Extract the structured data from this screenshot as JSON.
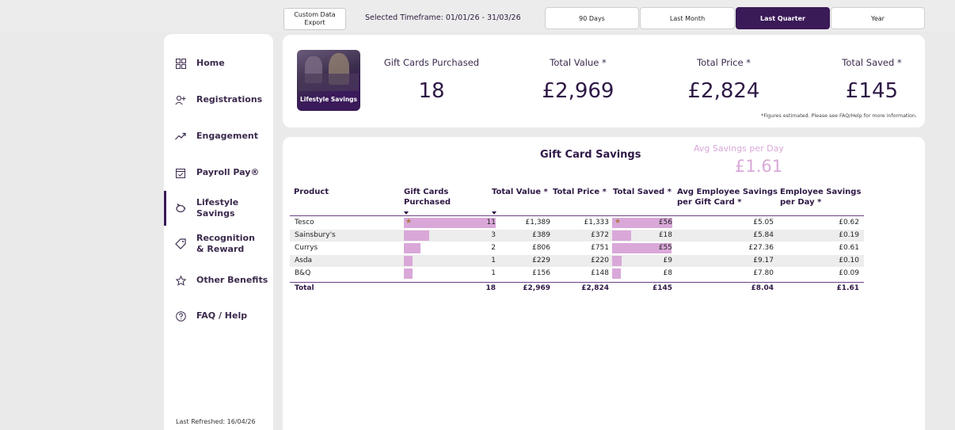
{
  "header": {
    "export_label": "Custom Data\nExport",
    "timeframe": "Selected Timeframe: 01/01/26 - 31/03/26",
    "timeframe_buttons": [
      {
        "label": "90 Days",
        "active": false
      },
      {
        "label": "Last Month",
        "active": false
      },
      {
        "label": "Last Quarter",
        "active": true
      },
      {
        "label": "Year",
        "active": false
      }
    ]
  },
  "sidebar": {
    "items": [
      {
        "label": "Home",
        "icon": "grid-icon"
      },
      {
        "label": "Registrations",
        "icon": "user-add-icon"
      },
      {
        "label": "Engagement",
        "icon": "trend-icon"
      },
      {
        "label": "Payroll Pay®",
        "icon": "calendar-check-icon"
      },
      {
        "label": "Lifestyle Savings",
        "icon": "piggy-bank-icon",
        "active": true
      },
      {
        "label": "Recognition\n& Reward",
        "icon": "tag-icon"
      },
      {
        "label": "Other Benefits",
        "icon": "star-icon"
      },
      {
        "label": "FAQ / Help",
        "icon": "help-icon"
      }
    ],
    "refreshed": "Last Refreshed: 16/04/26"
  },
  "kpis": {
    "image_caption": "Lifestyle Savings",
    "items": [
      {
        "title": "Gift Cards Purchased",
        "value": "18"
      },
      {
        "title": "Total Value *",
        "value": "£2,969"
      },
      {
        "title": "Total Price *",
        "value": "£2,824"
      },
      {
        "title": "Total Saved *",
        "value": "£145"
      }
    ],
    "note": "*Figures estimated. Please see FAQ/Help for more information."
  },
  "table": {
    "title": "Gift Card Savings",
    "avg_title": "Avg Savings per Day",
    "avg_value": "£1.61",
    "columns": [
      "Product",
      "Gift Cards\nPurchased",
      "Total Value *",
      "Total Price *",
      "Total Saved *",
      "Avg Employee Savings\nper Gift Card *",
      "Employee Savings\nper Day *"
    ],
    "rows": [
      {
        "product": "Tesco",
        "cards": "11",
        "value": "£1,389",
        "price": "£1,333",
        "saved": "£56",
        "avg": "£5.05",
        "per_day": "£0.62",
        "cards_n": 11,
        "saved_n": 56
      },
      {
        "product": "Sainsbury's",
        "cards": "3",
        "value": "£389",
        "price": "£372",
        "saved": "£18",
        "avg": "£5.84",
        "per_day": "£0.19",
        "cards_n": 3,
        "saved_n": 18
      },
      {
        "product": "Currys",
        "cards": "2",
        "value": "£806",
        "price": "£751",
        "saved": "£55",
        "avg": "£27.36",
        "per_day": "£0.61",
        "cards_n": 2,
        "saved_n": 55
      },
      {
        "product": "Asda",
        "cards": "1",
        "value": "£229",
        "price": "£220",
        "saved": "£9",
        "avg": "£9.17",
        "per_day": "£0.10",
        "cards_n": 1,
        "saved_n": 9
      },
      {
        "product": "B&Q",
        "cards": "1",
        "value": "£156",
        "price": "£148",
        "saved": "£8",
        "avg": "£7.80",
        "per_day": "£0.09",
        "cards_n": 1,
        "saved_n": 8
      }
    ],
    "total": {
      "product": "Total",
      "cards": "18",
      "value": "£2,969",
      "price": "£2,824",
      "saved": "£145",
      "avg": "£8.04",
      "per_day": "£1.61"
    }
  },
  "colors": {
    "brand": "#3b1a58",
    "accent": "#d9a8d9"
  }
}
